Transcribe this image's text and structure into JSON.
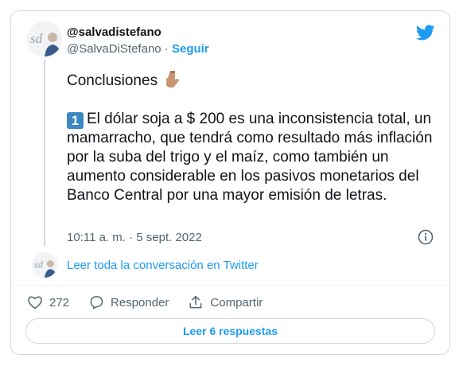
{
  "author": {
    "display_name": "@salvadistefano",
    "handle": "@SalvaDiStefano",
    "separator": "·",
    "follow_label": "Seguir"
  },
  "tweet": {
    "line1": "Conclusiones",
    "keycap": "1",
    "line2": "El dólar soja a $ 200 es una inconsistencia total, un mamarracho, que tendrá como resultado más inflación por la suba del trigo y el maíz, como también un aumento considerable en los pasivos monetarios del Banco Central por una mayor emisión de letras.",
    "timestamp": "10:11 a. m. · 5 sept. 2022"
  },
  "conversation_link": "Leer toda la conversación en Twitter",
  "actions": {
    "likes": "272",
    "reply_label": "Responder",
    "share_label": "Compartir"
  },
  "replies_button": "Leer 6 respuestas",
  "colors": {
    "accent": "#1d9bf0",
    "text": "#0f1419",
    "muted": "#536471",
    "border": "#cfd9de"
  },
  "icons": [
    "twitter-bird-icon",
    "pointing-down-emoji",
    "keycap-1-emoji",
    "info-icon",
    "heart-icon",
    "reply-bubble-icon",
    "share-icon"
  ]
}
